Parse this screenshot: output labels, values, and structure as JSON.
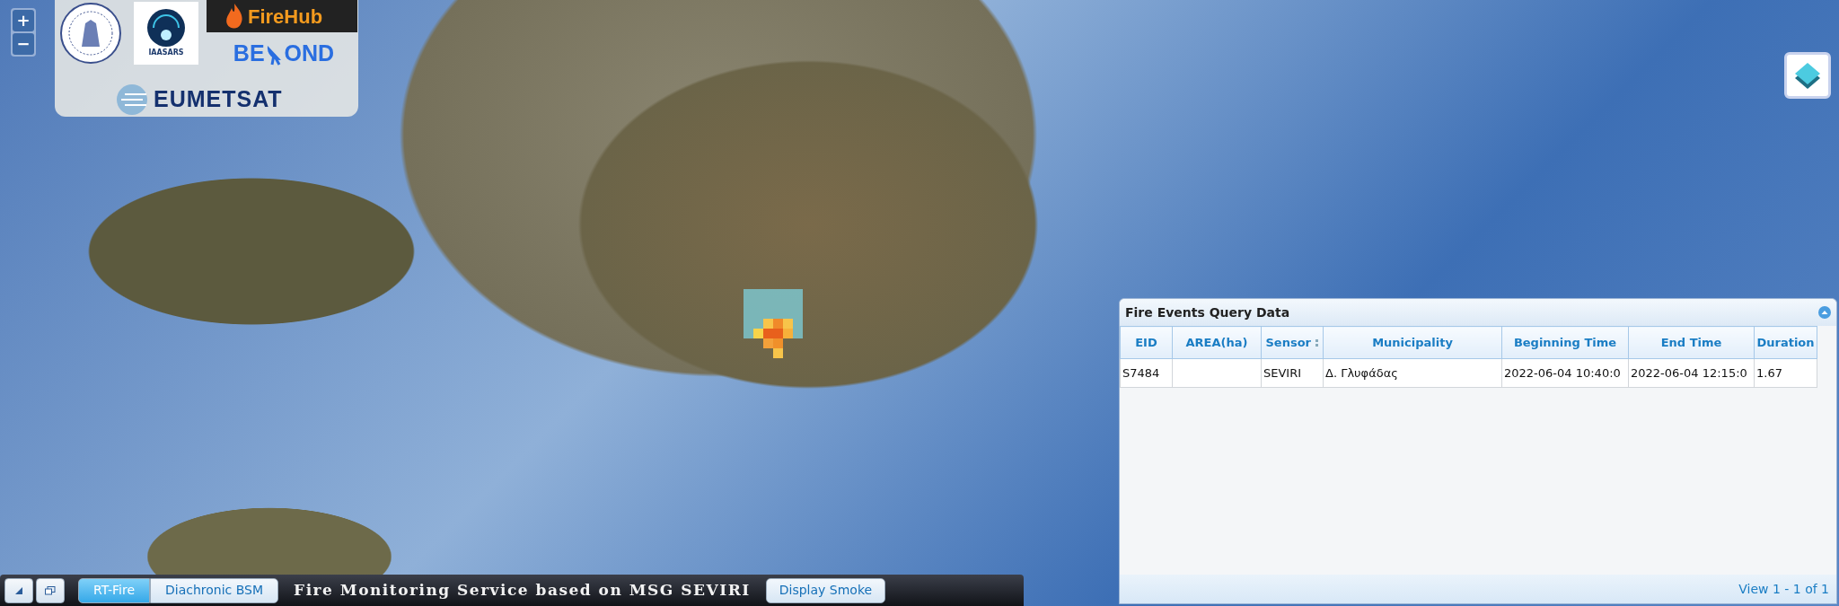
{
  "map_controls": {
    "zoom_in": "+",
    "zoom_out": "−"
  },
  "logos": {
    "iaasars": "IAASARS",
    "firehub": "FireHub",
    "beyond": {
      "text_start": "BE",
      "text_end": "OND"
    },
    "eumetsat": "EUMETSAT"
  },
  "query_panel": {
    "title": "Fire Events Query Data",
    "table": {
      "columns": [
        {
          "label": "EID",
          "sortable": false
        },
        {
          "label": "AREA(ha)",
          "sortable": false
        },
        {
          "label": "Sensor",
          "sortable": true
        },
        {
          "label": "Municipality",
          "sortable": false
        },
        {
          "label": "Beginning Time",
          "sortable": false
        },
        {
          "label": "End Time",
          "sortable": false
        },
        {
          "label": "Duration",
          "sortable": false
        }
      ],
      "rows": [
        [
          "S7484",
          "",
          "SEVIRI",
          "Δ. Γλυφάδας",
          "2022-06-04 10:40:0",
          "2022-06-04 12:15:0",
          "1.67"
        ]
      ]
    },
    "pager": "View 1 - 1 of 1"
  },
  "bottom_bar": {
    "tabs": [
      {
        "label": "RT-Fire",
        "selected": true
      },
      {
        "label": "Diachronic BSM",
        "selected": false
      }
    ],
    "title": "Fire Monitoring Service based on MSG SEVIRI",
    "smoke_button": "Display Smoke"
  }
}
